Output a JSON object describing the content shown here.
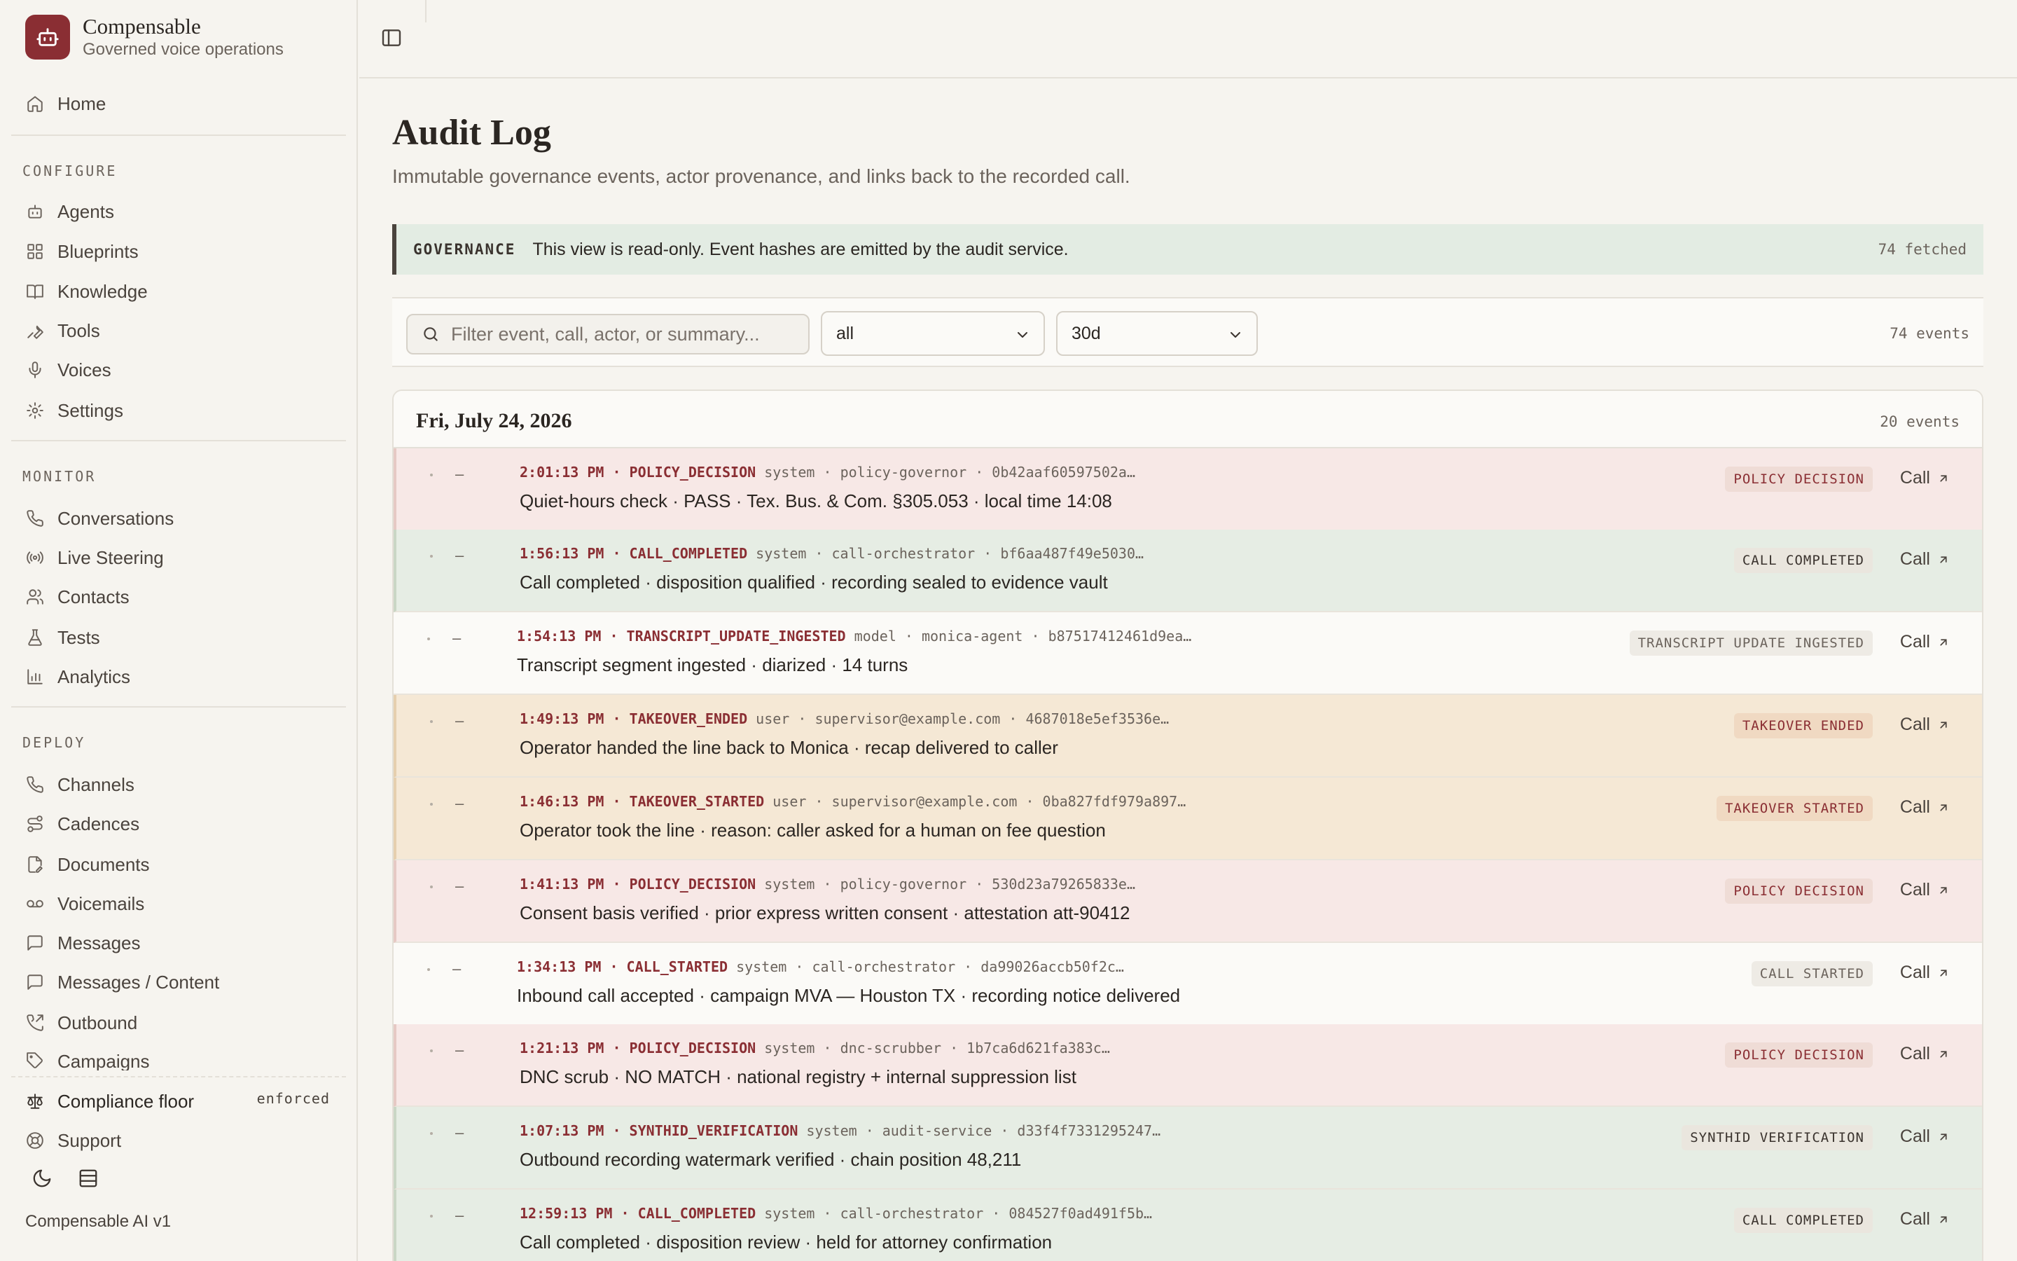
{
  "brand": {
    "name": "Compensable",
    "subtitle": "Governed voice operations"
  },
  "nav": {
    "home": "Home",
    "configure_label": "CONFIGURE",
    "configure": [
      "Agents",
      "Blueprints",
      "Knowledge",
      "Tools",
      "Voices",
      "Settings"
    ],
    "monitor_label": "MONITOR",
    "monitor": [
      "Conversations",
      "Live Steering",
      "Contacts",
      "Tests",
      "Analytics"
    ],
    "deploy_label": "DEPLOY",
    "deploy": [
      "Channels",
      "Cadences",
      "Documents",
      "Voicemails",
      "Messages",
      "Messages / Content",
      "Outbound",
      "Campaigns"
    ],
    "compliance": "Compliance floor",
    "compliance_status": "enforced",
    "support": "Support",
    "version": "Compensable AI v1"
  },
  "page": {
    "title": "Audit Log",
    "subtitle": "Immutable governance events, actor provenance, and links back to the recorded call."
  },
  "banner": {
    "tag": "GOVERNANCE",
    "text": "This view is read-only. Event hashes are emitted by the audit service.",
    "count": "74 fetched"
  },
  "filters": {
    "search_placeholder": "Filter event, call, actor, or summary...",
    "type_value": "all",
    "range_value": "30d",
    "count": "74 events"
  },
  "log": {
    "date": "Fri, July 24, 2026",
    "count": "20 events",
    "call_label": "Call",
    "rows": [
      {
        "time": "2:01:13 PM",
        "event": "POLICY_DECISION",
        "meta": "system · policy-governor · 0b42aaf60597502a…",
        "summary": "Quiet-hours check · PASS · Tex. Bus. & Com. §305.053 · local time 14:08",
        "badge": "POLICY DECISION",
        "tone": "policy"
      },
      {
        "time": "1:56:13 PM",
        "event": "CALL_COMPLETED",
        "meta": "system · call-orchestrator · bf6aa487f49e5030…",
        "summary": "Call completed · disposition qualified · recording sealed to evidence vault",
        "badge": "CALL COMPLETED",
        "tone": "ok"
      },
      {
        "time": "1:54:13 PM",
        "event": "TRANSCRIPT_UPDATE_INGESTED",
        "meta": "model · monica-agent · b87517412461d9ea…",
        "summary": "Transcript segment ingested · diarized · 14 turns",
        "badge": "TRANSCRIPT UPDATE INGESTED",
        "tone": "neutral"
      },
      {
        "time": "1:49:13 PM",
        "event": "TAKEOVER_ENDED",
        "meta": "user · supervisor@example.com · 4687018e5ef3536e…",
        "summary": "Operator handed the line back to Monica · recap delivered to caller",
        "badge": "TAKEOVER ENDED",
        "tone": "takeover"
      },
      {
        "time": "1:46:13 PM",
        "event": "TAKEOVER_STARTED",
        "meta": "user · supervisor@example.com · 0ba827fdf979a897…",
        "summary": "Operator took the line · reason: caller asked for a human on fee question",
        "badge": "TAKEOVER STARTED",
        "tone": "takeover"
      },
      {
        "time": "1:41:13 PM",
        "event": "POLICY_DECISION",
        "meta": "system · policy-governor · 530d23a79265833e…",
        "summary": "Consent basis verified · prior express written consent · attestation att-90412",
        "badge": "POLICY DECISION",
        "tone": "policy"
      },
      {
        "time": "1:34:13 PM",
        "event": "CALL_STARTED",
        "meta": "system · call-orchestrator · da99026accb50f2c…",
        "summary": "Inbound call accepted · campaign MVA — Houston TX · recording notice delivered",
        "badge": "CALL STARTED",
        "tone": "neutral"
      },
      {
        "time": "1:21:13 PM",
        "event": "POLICY_DECISION",
        "meta": "system · dnc-scrubber · 1b7ca6d621fa383c…",
        "summary": "DNC scrub · NO MATCH · national registry + internal suppression list",
        "badge": "POLICY DECISION",
        "tone": "policy"
      },
      {
        "time": "1:07:13 PM",
        "event": "SYNTHID_VERIFICATION",
        "meta": "system · audit-service · d33f4f7331295247…",
        "summary": "Outbound recording watermark verified · chain position 48,211",
        "badge": "SYNTHID VERIFICATION",
        "tone": "ok"
      },
      {
        "time": "12:59:13 PM",
        "event": "CALL_COMPLETED",
        "meta": "system · call-orchestrator · 084527f0ad491f5b…",
        "summary": "Call completed · disposition review · held for attorney confirmation",
        "badge": "CALL COMPLETED",
        "tone": "ok"
      }
    ]
  },
  "colors": {
    "accent": "#8a2e33",
    "policy_bg": "#f7e8e6",
    "policy_badge": "#efdcd6",
    "policy_text": "#8a2e33",
    "ok_bg": "#e6ede4",
    "ok_badge": "#eae6de",
    "ok_text": "#3a332e",
    "neutral_bg": "#fbfaf7",
    "neutral_badge": "#eeebe5",
    "neutral_text": "#6b635c",
    "takeover_bg": "#f5e8d5",
    "takeover_badge": "#f0d9c2",
    "takeover_text": "#8a2e33"
  }
}
